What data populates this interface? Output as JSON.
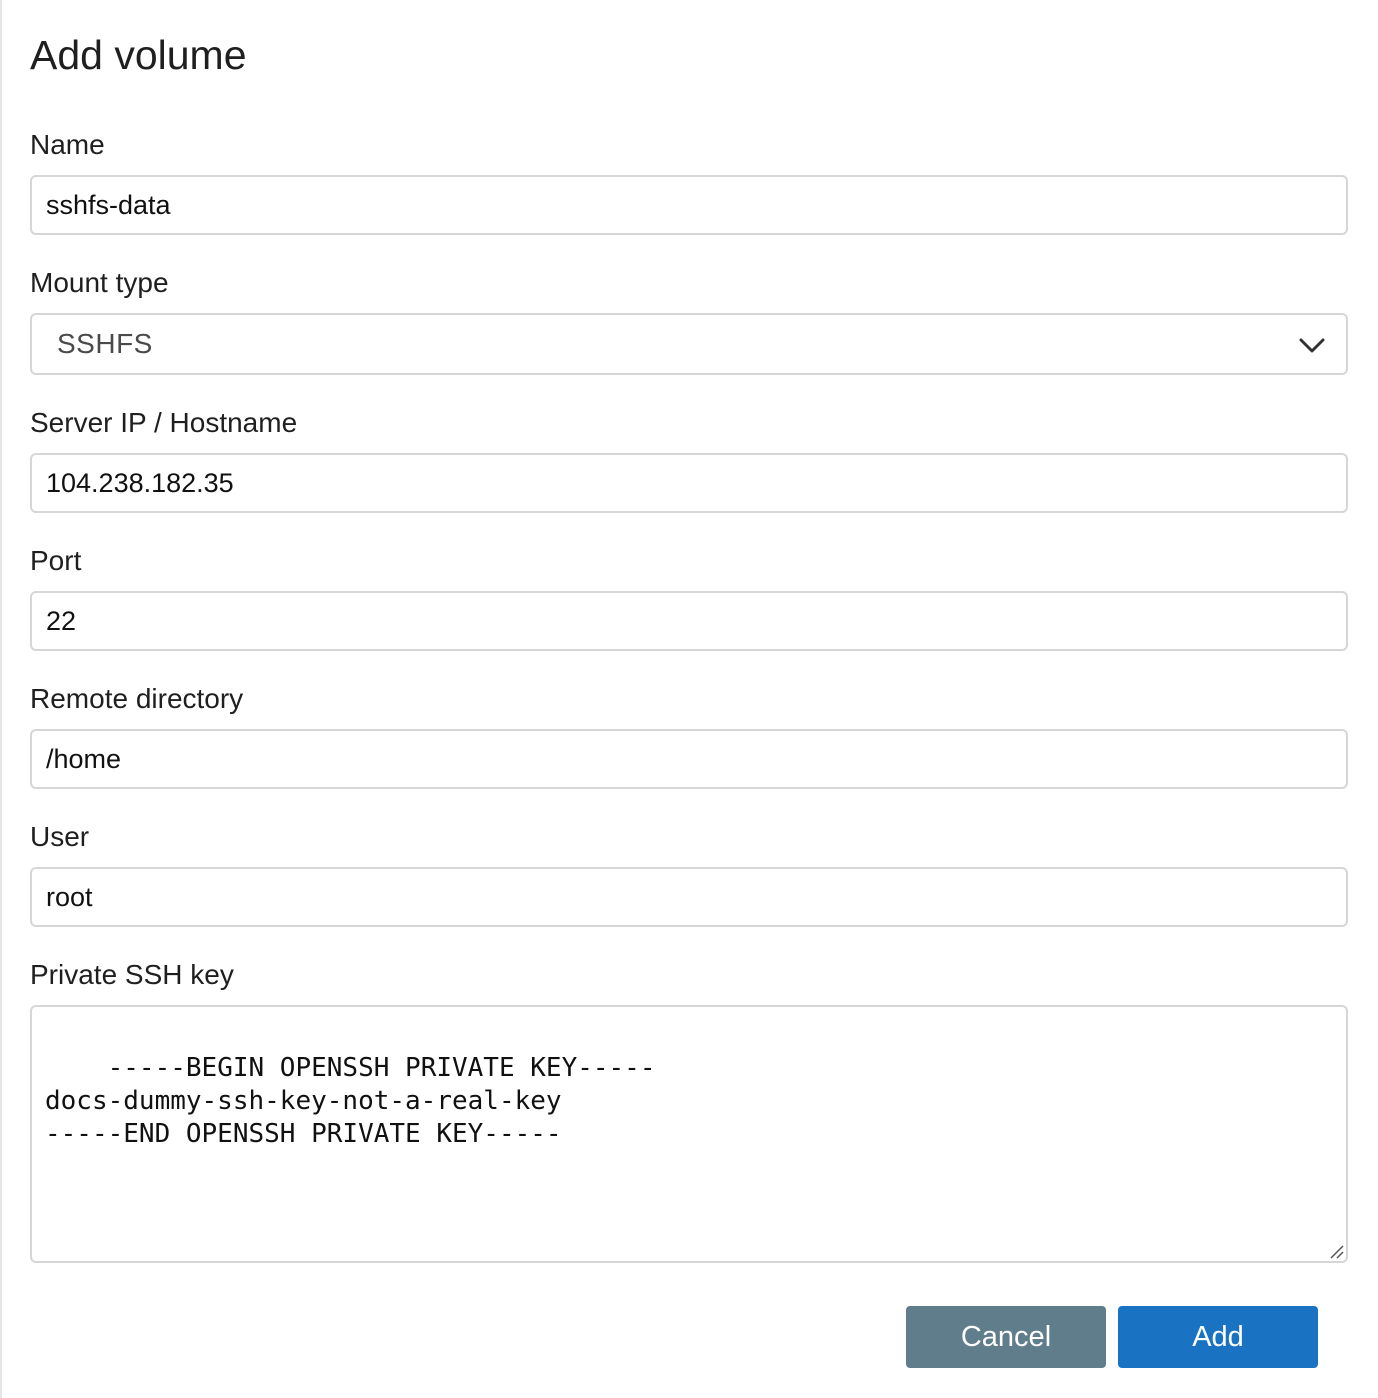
{
  "dialog": {
    "title": "Add volume"
  },
  "fields": {
    "name": {
      "label": "Name",
      "value": "sshfs-data"
    },
    "mount_type": {
      "label": "Mount type",
      "value": "SSHFS"
    },
    "server": {
      "label": "Server IP / Hostname",
      "value": "104.238.182.35"
    },
    "port": {
      "label": "Port",
      "value": "22"
    },
    "remote_dir": {
      "label": "Remote directory",
      "value": "/home"
    },
    "user": {
      "label": "User",
      "value": "root"
    },
    "ssh_key": {
      "label": "Private SSH key",
      "value": "-----BEGIN OPENSSH PRIVATE KEY-----\ndocs-dummy-ssh-key-not-a-real-key\n-----END OPENSSH PRIVATE KEY-----"
    }
  },
  "actions": {
    "cancel_label": "Cancel",
    "add_label": "Add"
  },
  "colors": {
    "cancel_button": "#607d8b",
    "add_button": "#1a73c2",
    "input_border": "#d6d6d6"
  },
  "icons": {
    "select_arrow": "chevron-down-icon",
    "textarea_resize": "resize-grip-icon"
  }
}
